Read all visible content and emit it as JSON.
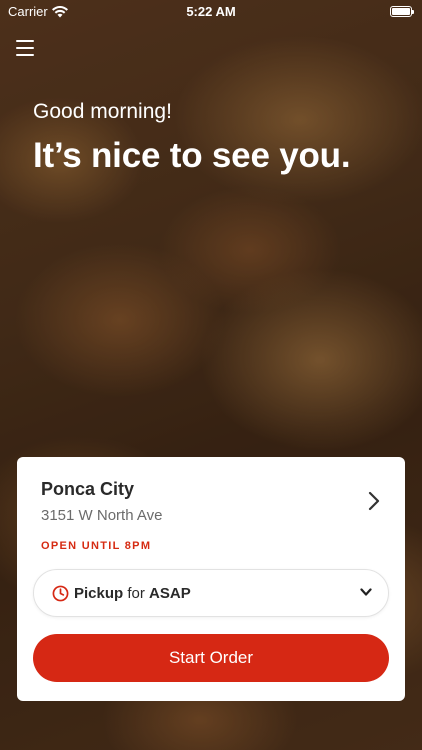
{
  "status_bar": {
    "carrier": "Carrier",
    "time": "5:22 AM"
  },
  "greeting": {
    "subtitle": "Good morning!",
    "headline": "It’s nice to see you."
  },
  "location": {
    "name": "Ponca City",
    "address": "3151 W North Ave",
    "hours": "OPEN UNTIL 8PM"
  },
  "order_mode": {
    "method": "Pickup",
    "connector": "for",
    "time": "ASAP"
  },
  "actions": {
    "start_order": "Start Order"
  },
  "icons": {
    "menu": "hamburger-menu-icon",
    "location_nav": "chevron-right-icon",
    "order_time": "clock-icon",
    "order_dropdown": "chevron-down-icon"
  },
  "colors": {
    "accent": "#d62814",
    "hours_text": "#d62b12"
  }
}
